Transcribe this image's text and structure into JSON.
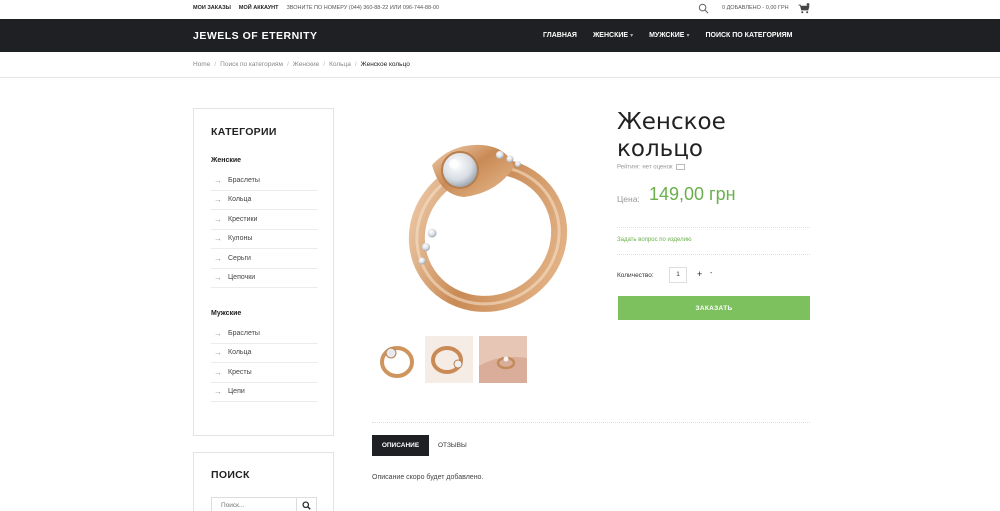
{
  "topbar": {
    "my_orders": "МОИ ЗАКАЗЫ",
    "my_account": "МОЙ АККАУНТ",
    "phone": "ЗВОНИТЕ ПО НОМЕРУ (044) 360-88-22 ИЛИ 096-744-88-00",
    "cart_summary": "0 ДОБАВЛЕНО - 0,00 ГРН"
  },
  "header": {
    "logo": "JEWELS OF ETERNITY",
    "nav": [
      {
        "label": "ГЛАВНАЯ",
        "has_caret": false
      },
      {
        "label": "ЖЕНСКИЕ",
        "has_caret": true
      },
      {
        "label": "МУЖСКИЕ",
        "has_caret": true
      },
      {
        "label": "ПОИСК ПО КАТЕГОРИЯМ",
        "has_caret": false
      }
    ]
  },
  "breadcrumb": {
    "items": [
      "Home",
      "Поиск по категориям",
      "Женские",
      "Кольца"
    ],
    "current": "Женское кольцо"
  },
  "sidebar": {
    "title": "КАТЕГОРИИ",
    "groups": [
      {
        "name": "Женские",
        "items": [
          "Браслеты",
          "Кольца",
          "Крестики",
          "Кулоны",
          "Серьги",
          "Цепочки"
        ]
      },
      {
        "name": "Мужские",
        "items": [
          "Браслеты",
          "Кольца",
          "Кресты",
          "Цепи"
        ]
      }
    ],
    "search_title": "ПОИСК",
    "search_placeholder": "Поиск..."
  },
  "product": {
    "title": "Женское кольцо",
    "rating": "Рейтинг: нет оценок",
    "price_label": "Цена:",
    "price": "149,00 грн",
    "ask_question": "Задать вопрос по изделию",
    "quantity_label": "Количество:",
    "quantity": "1",
    "plus": "+",
    "minus": "-",
    "order_button": "ЗАКАЗАТЬ"
  },
  "tabs": {
    "description": "ОПИСАНИЕ",
    "reviews": "ОТЗЫВЫ",
    "description_text": "Описание скоро будет добавлено."
  },
  "colors": {
    "accent": "#7dc15f",
    "price": "#6ab04c",
    "nav_bg": "#1f2023"
  }
}
